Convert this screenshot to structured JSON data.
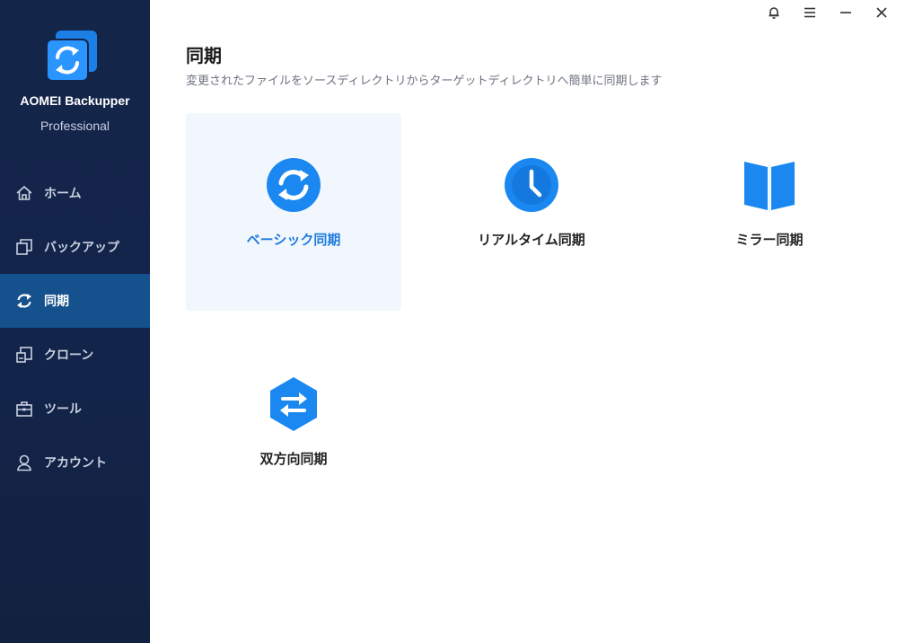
{
  "app": {
    "name": "AOMEI Backupper",
    "edition": "Professional"
  },
  "sidebar": {
    "items": [
      {
        "label": "ホーム",
        "icon": "home-icon",
        "active": false
      },
      {
        "label": "バックアップ",
        "icon": "backup-icon",
        "active": false
      },
      {
        "label": "同期",
        "icon": "sync-icon",
        "active": true
      },
      {
        "label": "クローン",
        "icon": "clone-icon",
        "active": false
      },
      {
        "label": "ツール",
        "icon": "tools-icon",
        "active": false
      },
      {
        "label": "アカウント",
        "icon": "account-icon",
        "active": false
      }
    ]
  },
  "window": {
    "controls": [
      "bell-icon",
      "menu-icon",
      "minimize-icon",
      "close-icon"
    ]
  },
  "main": {
    "title": "同期",
    "subtitle": "変更されたファイルをソースディレクトリからターゲットディレクトリへ簡単に同期します",
    "options": [
      {
        "label": "ベーシック同期",
        "icon": "basic-sync-icon",
        "selected": true
      },
      {
        "label": "リアルタイム同期",
        "icon": "clock-icon",
        "selected": false
      },
      {
        "label": "ミラー同期",
        "icon": "mirror-icon",
        "selected": false
      },
      {
        "label": "双方向同期",
        "icon": "two-way-sync-icon",
        "selected": false
      }
    ]
  },
  "colors": {
    "sidebar_bg": "#14254a",
    "sidebar_active": "#15518d",
    "accent": "#1f7ae0",
    "icon_blue": "#1a88f0"
  }
}
